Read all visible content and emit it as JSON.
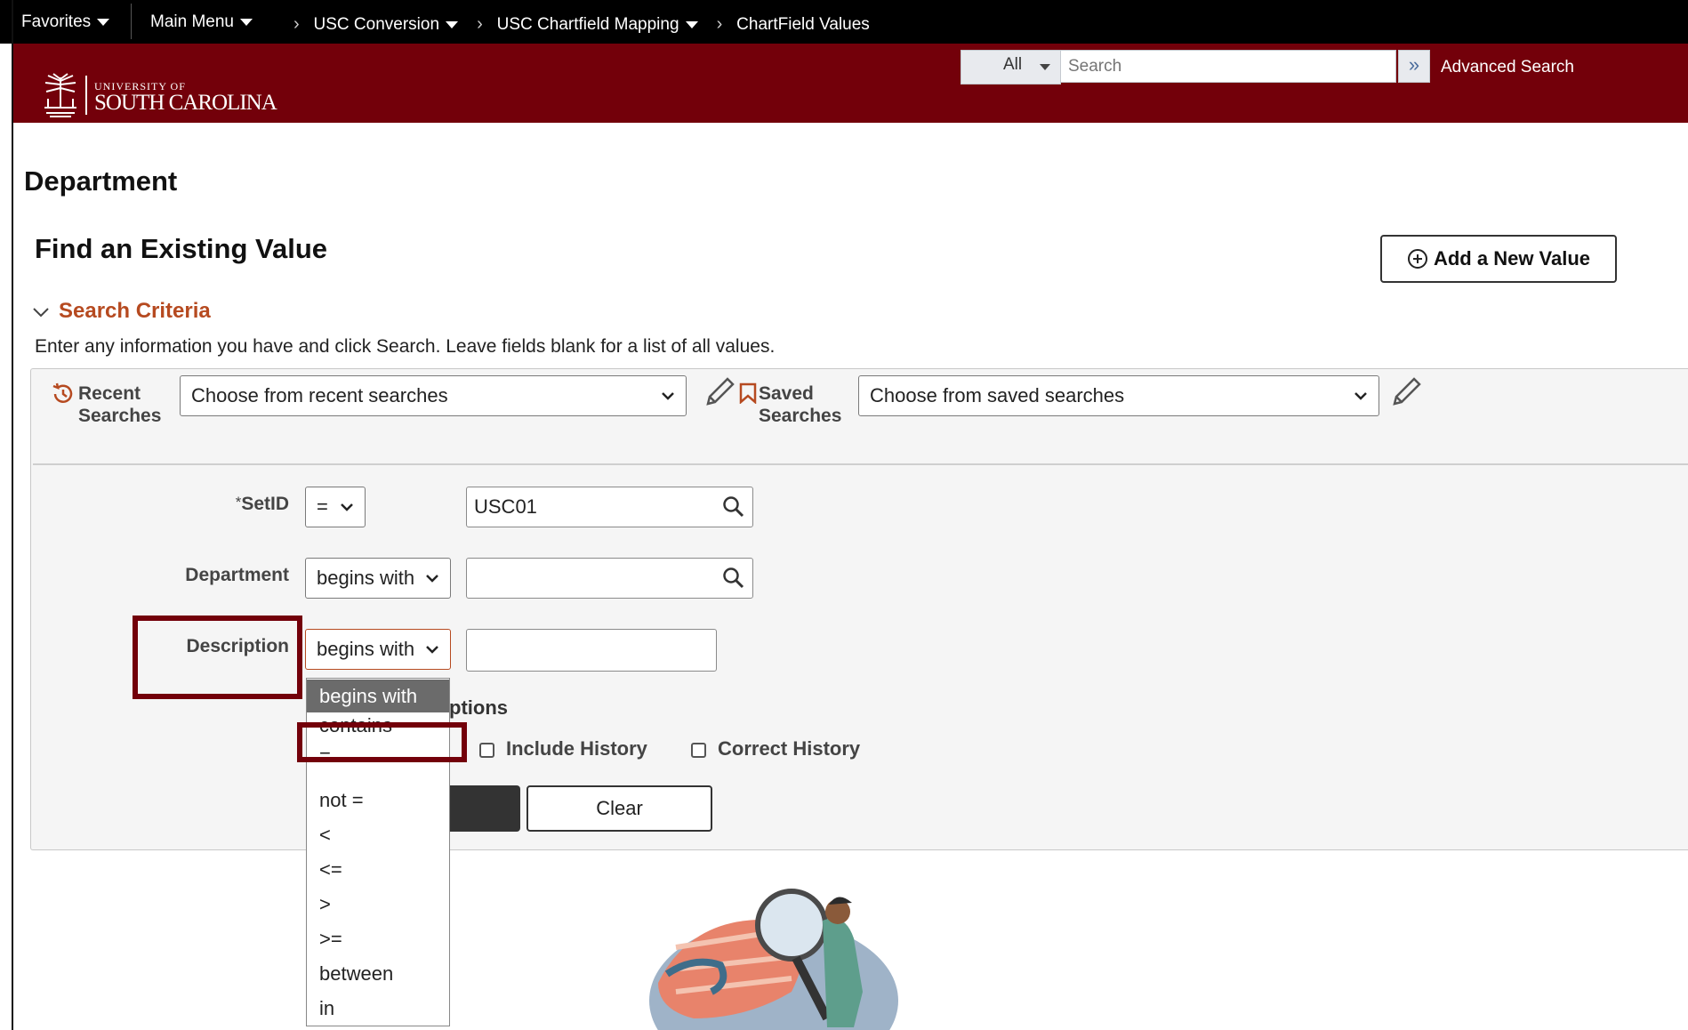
{
  "nav": {
    "favorites": "Favorites",
    "main_menu": "Main Menu",
    "breadcrumbs": [
      "USC Conversion",
      "USC Chartfield Mapping",
      "ChartField Values"
    ]
  },
  "header": {
    "logo_small": "UNIVERSITY OF",
    "logo_large": "SOUTH CAROLINA",
    "scope": "All",
    "search_placeholder": "Search",
    "advanced_search": "Advanced Search"
  },
  "page": {
    "title": "Department",
    "subtitle": "Find an Existing Value",
    "add_button": "Add a New Value",
    "criteria_label": "Search Criteria",
    "instructions": "Enter any information you have and click Search. Leave fields blank for a list of all values."
  },
  "recent": {
    "label_line1": "Recent",
    "label_line2": "Searches",
    "select": "Choose from recent searches"
  },
  "saved": {
    "label_line1": "Saved",
    "label_line2": "Searches",
    "select": "Choose from saved searches"
  },
  "fields": {
    "setid": {
      "required_mark": "*",
      "label": "SetID",
      "operator": "=",
      "value": "USC01"
    },
    "department": {
      "label": "Department",
      "operator": "begins with",
      "value": ""
    },
    "description": {
      "label": "Description",
      "operator": "begins with",
      "value": ""
    }
  },
  "options": {
    "heading_fragment": "ptions",
    "include_history": "Include History",
    "correct_history": "Correct History"
  },
  "buttons": {
    "clear": "Clear"
  },
  "dropdown": {
    "items": [
      "begins with",
      "contains",
      "=",
      "not =",
      "<",
      "<=",
      ">",
      ">=",
      "between",
      "in"
    ],
    "selected": "begins with"
  },
  "colors": {
    "brand": "#73000a",
    "accent": "#b64a20"
  }
}
